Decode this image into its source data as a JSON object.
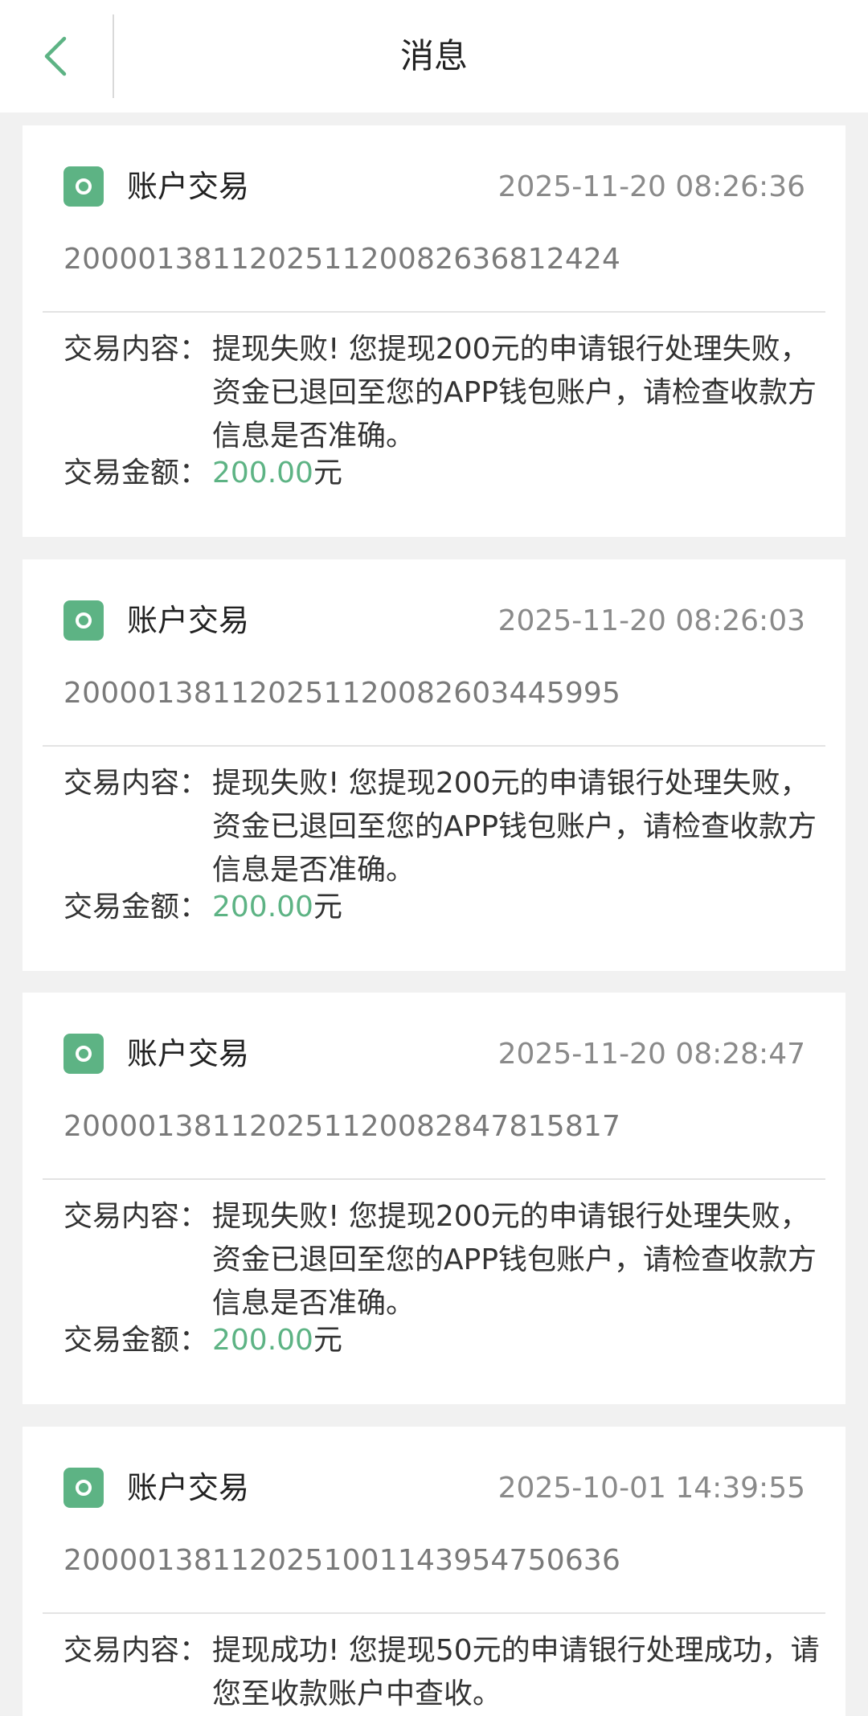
{
  "header": {
    "title": "消息",
    "back_icon": "chevron-left-icon"
  },
  "colors": {
    "accent": "#5db384",
    "background": "#f1f1f1"
  },
  "messages": [
    {
      "type": "账户交易",
      "time": "2025-11-20 08:26:36",
      "order_no": "200001381120251120082636812424",
      "content_label": "交易内容：",
      "content": "提现失败! 您提现200元的申请银行处理失败，\n资金已退回至您的APP钱包账户，请检查收款方\n信息是否准确。",
      "amount_label": "交易金额：",
      "amount": "200.00",
      "amount_unit": "元"
    },
    {
      "type": "账户交易",
      "time": "2025-11-20 08:26:03",
      "order_no": "200001381120251120082603445995",
      "content_label": "交易内容：",
      "content": "提现失败! 您提现200元的申请银行处理失败，\n资金已退回至您的APP钱包账户，请检查收款方\n信息是否准确。",
      "amount_label": "交易金额：",
      "amount": "200.00",
      "amount_unit": "元"
    },
    {
      "type": "账户交易",
      "time": "2025-11-20 08:28:47",
      "order_no": "200001381120251120082847815817",
      "content_label": "交易内容：",
      "content": "提现失败! 您提现200元的申请银行处理失败，\n资金已退回至您的APP钱包账户，请检查收款方\n信息是否准确。",
      "amount_label": "交易金额：",
      "amount": "200.00",
      "amount_unit": "元"
    },
    {
      "type": "账户交易",
      "time": "2025-10-01 14:39:55",
      "order_no": "200001381120251001143954750636",
      "content_label": "交易内容：",
      "content": "提现成功! 您提现50元的申请银行处理成功，请\n您至收款账户中查收。"
    }
  ]
}
